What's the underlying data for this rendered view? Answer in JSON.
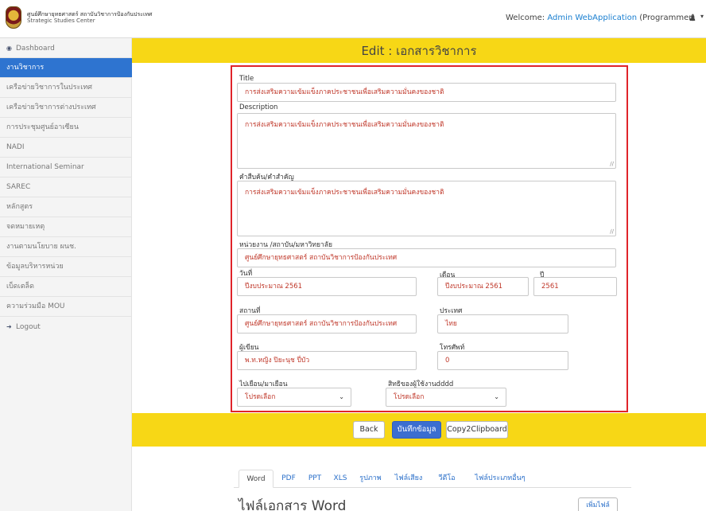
{
  "header": {
    "brand_thai": "ศูนย์ศึกษายุทธศาสตร์ สถาบันวิชาการป้องกันประเทศ",
    "brand_english": "Strategic Studies Center",
    "welcome_prefix": "Welcome:",
    "username": "Admin WebApplication",
    "role": "(Programmer)",
    "user_icon": "user-icon"
  },
  "sidebar": {
    "items": [
      {
        "label": "Dashboard",
        "icon": "dashboard-icon"
      },
      {
        "label": "งานวิชาการ"
      },
      {
        "label": "เครือข่ายวิชาการในประเทศ"
      },
      {
        "label": "เครือข่ายวิชาการต่างประเทศ"
      },
      {
        "label": "การประชุมศูนย์อาเซียน"
      },
      {
        "label": "NADI"
      },
      {
        "label": "International Seminar"
      },
      {
        "label": "SAREC"
      },
      {
        "label": "หลักสูตร"
      },
      {
        "label": "จดหมายเหตุ"
      },
      {
        "label": "งานตามนโยบาย ผนช."
      },
      {
        "label": "ข้อมูลบริหารหน่วย"
      },
      {
        "label": "เบ็ดเตล็ด"
      },
      {
        "label": "ความร่วมมือ MOU"
      },
      {
        "label": "Logout",
        "icon": "logout-icon"
      }
    ],
    "active_index": 1
  },
  "page": {
    "title": "Edit : เอกสารวิชาการ"
  },
  "form": {
    "title_label": "Title",
    "title_value": "การส่งเสริมความเข้มแข็งภาคประชาชนเพื่อเสริมความมั่นคงของชาติ",
    "description_label": "Description",
    "description_value": "การส่งเสริมความเข้มแข็งภาคประชาชนเพื่อเสริมความมั่นคงของชาติ",
    "keywords_label": "คำสืบค้น/คำสำคัญ",
    "keywords_value": "การส่งเสริมความเข้มแข็งภาคประชาชนเพื่อเสริมความมั่นคงของชาติ",
    "agency_label": "หน่วยงาน /สถาบัน/มหาวิทยาลัย",
    "agency_value": "ศูนย์ศึกษายุทธศาสตร์ สถาบันวิชาการป้องกันประเทศ",
    "day_label": "วันที่",
    "day_value": "ปีงบประมาณ 2561",
    "month_label": "เดือน",
    "month_value": "ปีงบประมาณ 2561",
    "year_label": "ปี",
    "year_value": "2561",
    "place_label": "สถานที่",
    "place_value": "ศูนย์ศึกษายุทธศาสตร์ สถาบันวิชาการป้องกันประเทศ",
    "country_label": "ประเทศ",
    "country_value": "ไทย",
    "author_label": "ผู้เขียน",
    "author_value": "พ.ท.หญิง ปิยะนุช ปี่บัว",
    "phone_label": "โทรศัพท์",
    "phone_value": "0",
    "visit_label": "ไปเยือน/มาเยือน",
    "visit_value": "โปรดเลือก",
    "rights_label": "สิทธิของผู้ใช้งานdddd",
    "rights_value": "โปรดเลือก"
  },
  "actions": {
    "back": "Back",
    "save": "บันทึกข้อมูล",
    "copy": "Copy2Clipboard"
  },
  "files": {
    "tabs": [
      "Word",
      "PDF",
      "PPT",
      "XLS",
      "รูปภาพ",
      "ไฟล์เสียง",
      "วีดีโอ",
      "ไฟล์ประเภทอื่นๆ"
    ],
    "active_tab": "Word",
    "heading": "ไฟล์เอกสาร Word",
    "add_button": "เพิ่มไฟล์"
  }
}
